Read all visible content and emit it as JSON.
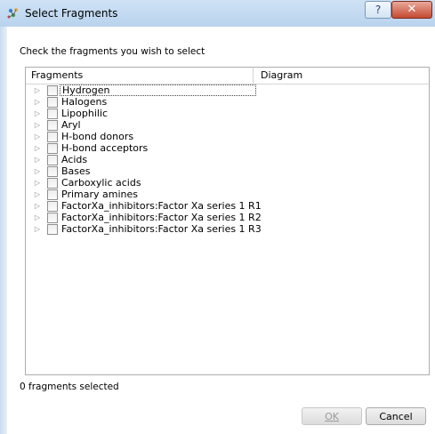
{
  "window": {
    "title": "Select Fragments",
    "help_label": "?",
    "close_label": "✕"
  },
  "instruction": "Check the fragments you wish to select",
  "tree": {
    "columns": [
      "Fragments",
      "Diagram"
    ],
    "rows": [
      {
        "label": "Hydrogen",
        "checked": false,
        "focused": true
      },
      {
        "label": "Halogens",
        "checked": false
      },
      {
        "label": "Lipophilic",
        "checked": false
      },
      {
        "label": "Aryl",
        "checked": false
      },
      {
        "label": "H-bond donors",
        "checked": false
      },
      {
        "label": "H-bond acceptors",
        "checked": false
      },
      {
        "label": "Acids",
        "checked": false
      },
      {
        "label": "Bases",
        "checked": false
      },
      {
        "label": "Carboxylic acids",
        "checked": false
      },
      {
        "label": "Primary amines",
        "checked": false
      },
      {
        "label": "FactorXa_inhibitors:Factor Xa series 1 R1",
        "checked": false
      },
      {
        "label": "FactorXa_inhibitors:Factor Xa series 1 R2",
        "checked": false
      },
      {
        "label": "FactorXa_inhibitors:Factor Xa series 1 R3",
        "checked": false
      }
    ]
  },
  "status": "0 fragments selected",
  "buttons": {
    "ok": "OK",
    "cancel": "Cancel"
  }
}
